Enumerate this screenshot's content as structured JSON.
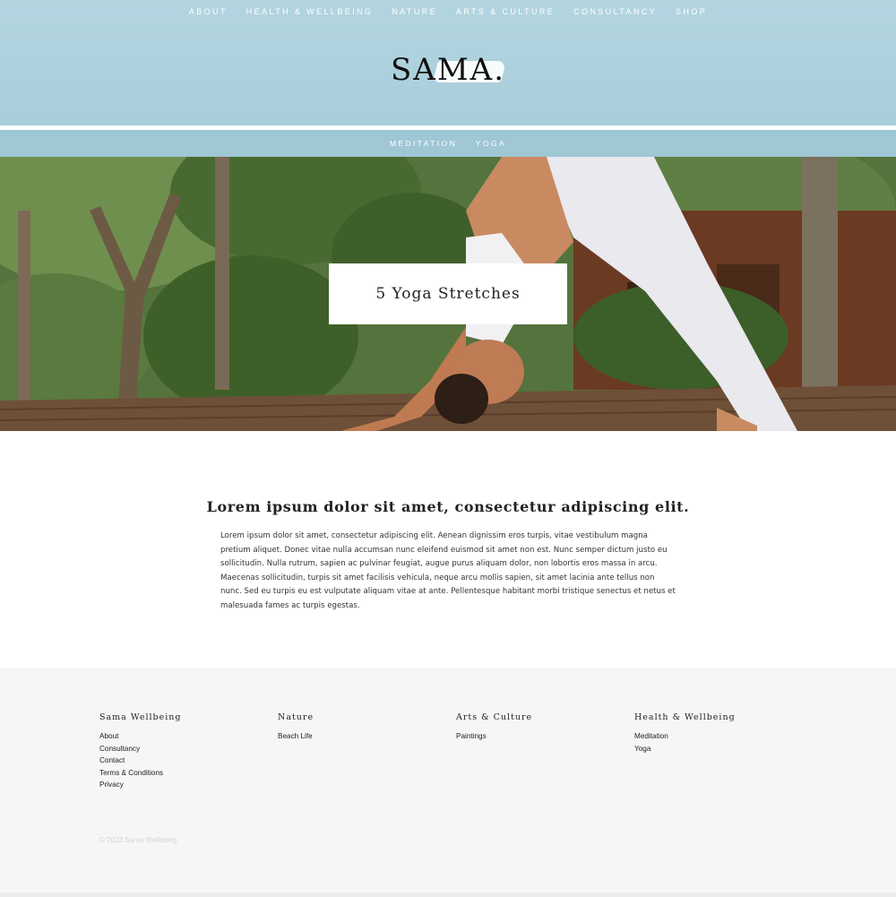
{
  "header": {
    "nav": [
      "ABOUT",
      "HEALTH & WELLBEING",
      "NATURE",
      "ARTS & CULTURE",
      "CONSULTANCY",
      "SHOP"
    ],
    "logo": "SAMA.",
    "subnav": [
      "MEDITATION",
      "YOGA"
    ],
    "colors": {
      "header_bg": "#a8cedb",
      "subnav_bg": "#9fc7d4"
    }
  },
  "hero": {
    "title": "5 Yoga Stretches"
  },
  "article": {
    "heading": "Lorem ipsum dolor sit amet, consectetur adipiscing elit.",
    "body": "Lorem ipsum dolor sit amet, consectetur adipiscing elit. Aenean dignissim eros turpis, vitae vestibulum magna pretium aliquet. Donec vitae nulla accumsan nunc eleifend euismod sit amet non est. Nunc semper dictum justo eu sollicitudin. Nulla rutrum, sapien ac pulvinar feugiat, augue purus aliquam dolor, non lobortis eros massa in arcu. Maecenas sollicitudin, turpis sit amet facilisis vehicula, neque arcu mollis sapien, sit amet lacinia ante tellus non nunc. Sed eu turpis eu est vulputate aliquam vitae at ante. Pellentesque habitant morbi tristique senectus et netus et malesuada fames ac turpis egestas."
  },
  "footer": {
    "columns": [
      {
        "title": "Sama Wellbeing",
        "links": [
          "About",
          "Consultancy",
          "Contact",
          "Terms & Conditions",
          "Privacy"
        ]
      },
      {
        "title": "Nature",
        "links": [
          "Beach Life"
        ]
      },
      {
        "title": "Arts & Culture",
        "links": [
          "Paintings"
        ]
      },
      {
        "title": "Health & Wellbeing",
        "links": [
          "Meditation",
          "Yoga"
        ]
      }
    ],
    "copyright": "© 2022 Sama Wellbeing"
  }
}
